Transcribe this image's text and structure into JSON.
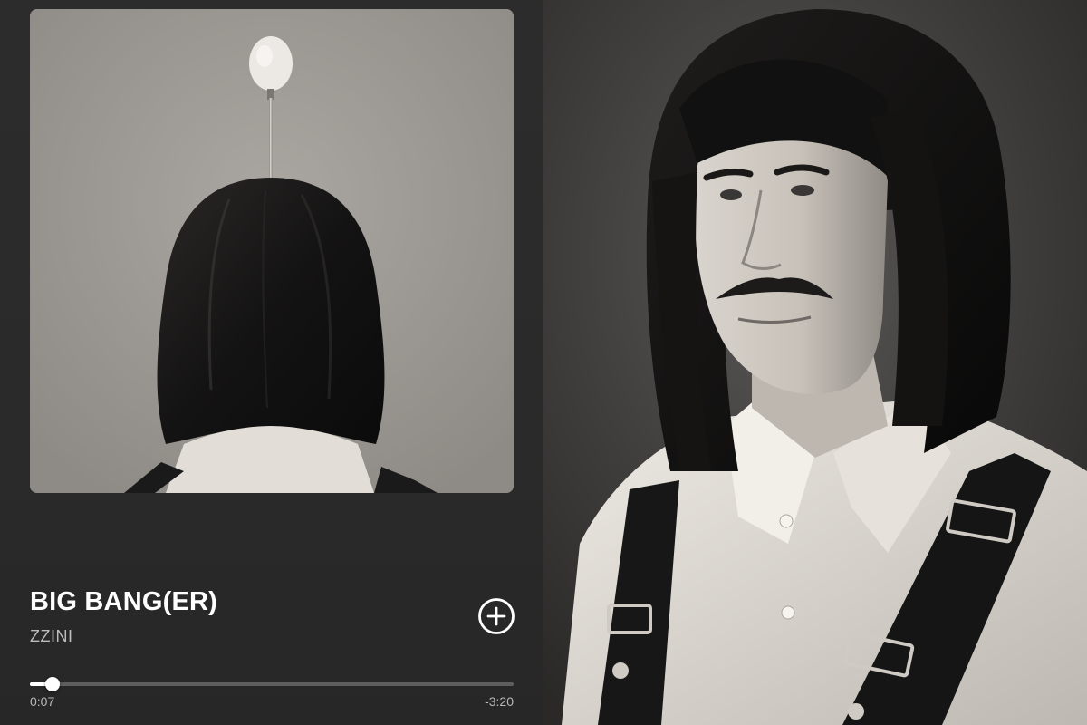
{
  "track": {
    "title": "BIG BANG(ER)",
    "artist": "ZZINI"
  },
  "controls": {
    "add_icon": "plus-circle-icon"
  },
  "playback": {
    "elapsed": "0:07",
    "remaining": "-3:20",
    "progress": 0.047
  },
  "colors": {
    "panel_bg": "#2a2a2a",
    "title": "#ffffff",
    "artist": "#bdbdbd",
    "progress_fill": "#ffffff",
    "progress_track": "#5e5e5e"
  }
}
